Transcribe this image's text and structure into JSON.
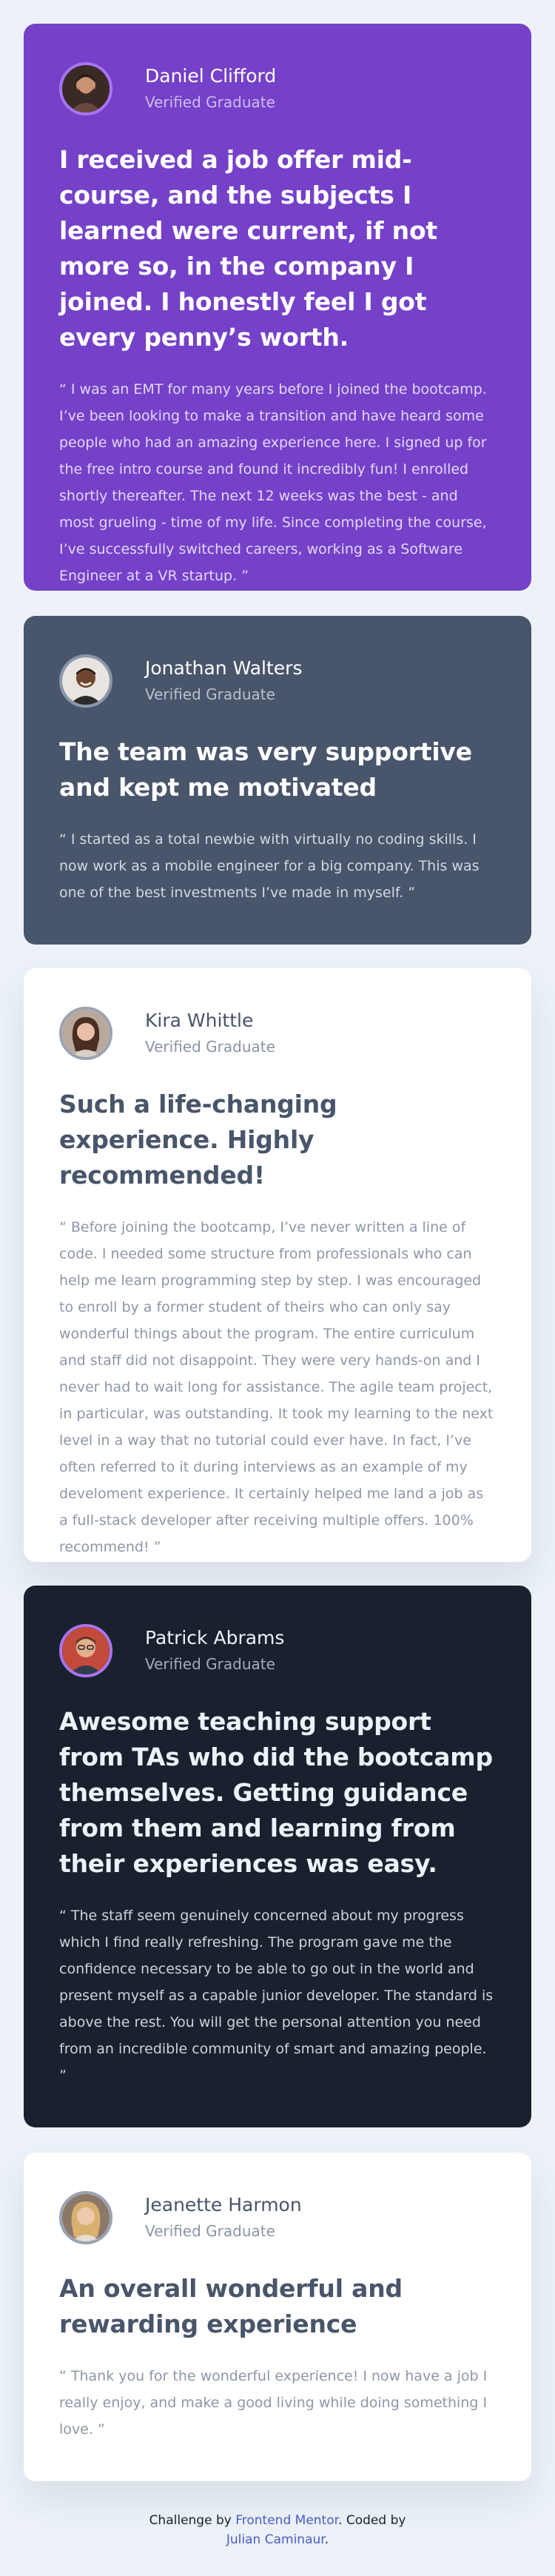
{
  "theme": {
    "page_bg": "#ECF2F8",
    "purple": "#7541C8",
    "slate": "#48556A",
    "white": "#FFFFFF",
    "dark": "#19212E"
  },
  "testimonials": [
    {
      "name": "Daniel Clifford",
      "role": "Verified Graduate",
      "avatar": "man-with-beard-avatar",
      "headline": "I received a job offer mid-course, and the subjects I learned were current, if not more so, in the company I joined. I honestly feel I got every penny’s worth.",
      "quote": "“ I was an EMT for many years before I joined the bootcamp. I’ve been looking to make a transition and have heard some people who had an amazing experience here. I signed up for the free intro course and found it incredibly fun! I enrolled shortly thereafter. The next 12 weeks was the best - and most grueling - time of my life. Since completing the course, I’ve successfully switched careers, working as a Software Engineer at a VR startup. ”"
    },
    {
      "name": "Jonathan Walters",
      "role": "Verified Graduate",
      "avatar": "smiling-man-avatar",
      "headline": "The team was very supportive and kept me motivated",
      "quote": "“ I started as a total newbie with virtually no coding skills. I now work as a mobile engineer for a big company. This was one of the best investments I’ve made in myself. ”"
    },
    {
      "name": "Kira Whittle",
      "role": "Verified Graduate",
      "avatar": "woman-avatar",
      "headline": "Such a life-changing experience. Highly recommended!",
      "quote": "“ Before joining the bootcamp, I’ve never written a line of code. I needed some structure from professionals who can help me learn programming step by step. I was encouraged to enroll by a former student of theirs who can only say wonderful things about the program. The entire curriculum and staff did not disappoint. They were very hands-on and I never had to wait long for assistance. The agile team project, in particular, was outstanding. It took my learning to the next level in a way that no tutorial could ever have. In fact, I’ve often referred to it during interviews as an example of my develoment experience. It certainly helped me land a job as a full-stack developer after receiving multiple offers. 100% recommend! ”"
    },
    {
      "name": "Patrick Abrams",
      "role": "Verified Graduate",
      "avatar": "man-with-glasses-avatar",
      "headline": "Awesome teaching support from TAs who did the bootcamp themselves. Getting guidance from them and learning from their experiences was easy.",
      "quote": "“ The staff seem genuinely concerned about my progress which I find really refreshing. The program gave me the confidence necessary to be able to go out in the world and present myself as a capable junior developer. The standard is above the rest. You will get the personal attention you need from an incredible community of smart and amazing people. ”"
    },
    {
      "name": "Jeanette Harmon",
      "role": "Verified Graduate",
      "avatar": "blonde-woman-avatar",
      "headline": "An overall wonderful and rewarding experience",
      "quote": "“ Thank you for the wonderful experience! I now have a job I really enjoy, and make a good living while doing something I love. ”"
    }
  ],
  "attribution": {
    "prefix": "Challenge by",
    "challenge_link": "Frontend Mentor",
    "middle": ". Coded by",
    "author_link": "Julian Caminaur",
    "suffix": "."
  }
}
